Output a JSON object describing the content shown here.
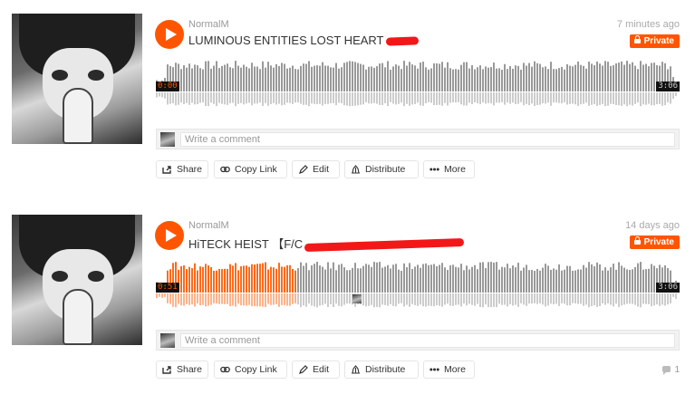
{
  "tracks": [
    {
      "user": "NormalM",
      "title": "LUMINOUS ENTITIES LOST HEART",
      "time_ago": "7 minutes ago",
      "privacy": "Private",
      "current_time": "0:00",
      "duration": "3:06",
      "progress": 0.0,
      "comment_placeholder": "Write a comment",
      "actions": {
        "share": "Share",
        "copy_link": "Copy Link",
        "edit": "Edit",
        "distribute": "Distribute",
        "more": "More"
      }
    },
    {
      "user": "NormalM",
      "title": "HiTECK HEIST 【F/C",
      "time_ago": "14 days ago",
      "privacy": "Private",
      "current_time": "0:51",
      "duration": "3:06",
      "progress": 0.27,
      "comment_placeholder": "Write a comment",
      "comments_count": "1",
      "actions": {
        "share": "Share",
        "copy_link": "Copy Link",
        "edit": "Edit",
        "distribute": "Distribute",
        "more": "More"
      }
    }
  ],
  "colors": {
    "accent": "#ff5500",
    "wave_played": "#ff6a1a",
    "wave_unplayed": "#999999",
    "wave_reflection": "#cccccc"
  }
}
